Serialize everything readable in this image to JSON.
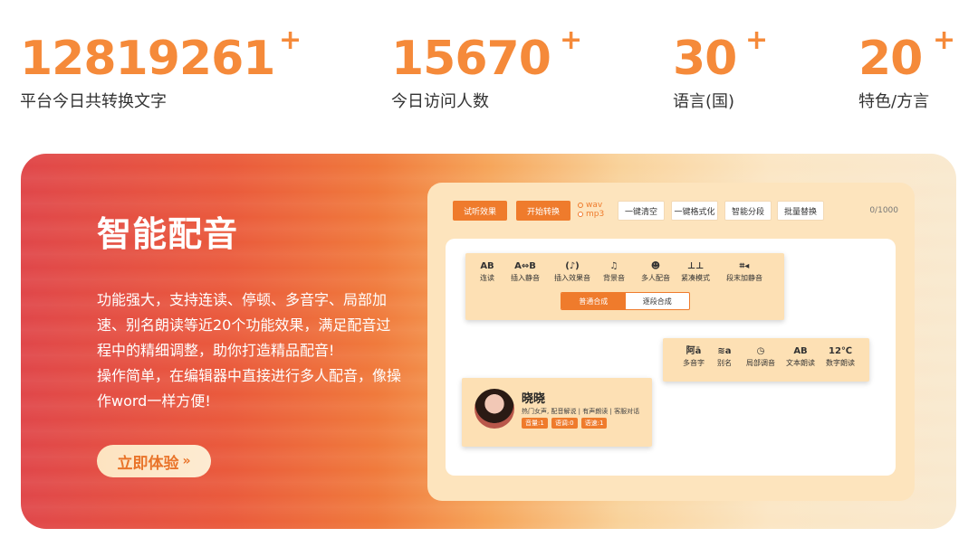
{
  "stats": [
    {
      "value": "12819261",
      "plus": "+",
      "label": "平台今日共转换文字"
    },
    {
      "value": "15670",
      "plus": "+",
      "label": "今日访问人数"
    },
    {
      "value": "30",
      "plus": "+",
      "label": "语言(国)"
    },
    {
      "value": "20",
      "plus": "+",
      "label": "特色/方言"
    }
  ],
  "banner": {
    "title": "智能配音",
    "desc_lines": [
      "功能强大，支持连读、停顿、多音字、局部加速、别名朗读等近20个功能效果，满足配音过程中的精细调整，助你打造精品配音!",
      "操作简单，在编辑器中直接进行多人配音，像操作word一样方便!"
    ],
    "cta_label": "立即体验",
    "cta_icon": "double-chevron-right-icon"
  },
  "editor": {
    "toolbar": {
      "try_label": "试听效果",
      "start_label": "开始转换",
      "formats": [
        "wav",
        "mp3"
      ],
      "clear_label": "一键清空",
      "format_label": "一键格式化",
      "seg_label": "智能分段",
      "replace_label": "批量替换",
      "counter": "0/1000"
    },
    "tools_top": [
      {
        "icon": "AB",
        "label": "连读"
      },
      {
        "icon": "A⇔B",
        "label": "插入静音"
      },
      {
        "icon": "(♪)",
        "label": "插入效果音"
      },
      {
        "icon": "♫",
        "label": "背景音"
      },
      {
        "icon": "☻",
        "label": "多人配音"
      },
      {
        "icon": "⊥⊥",
        "label": "紧凑模式"
      },
      {
        "icon": "⌗◂",
        "label": "段末加静音"
      }
    ],
    "synthesis": {
      "normal": "普通合成",
      "segment": "逐段合成"
    },
    "tools_mid": [
      {
        "icon": "阿ā",
        "label": "多音字"
      },
      {
        "icon": "≋a",
        "label": "别名"
      },
      {
        "icon": "◷",
        "label": "局部调音"
      },
      {
        "icon": "AB",
        "label": "文本朗读"
      },
      {
        "icon": "12℃",
        "label": "数字朗读"
      }
    ],
    "voice": {
      "name": "晓晓",
      "desc": "热门女声, 配音解说 | 有声朗读 | 客服对话",
      "tags": [
        "音量:1",
        "语调:0",
        "语速:1"
      ]
    }
  }
}
